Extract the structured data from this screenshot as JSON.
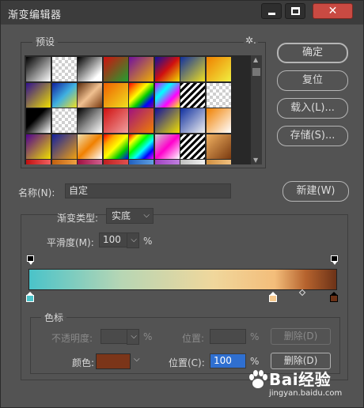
{
  "window": {
    "title": "渐变编辑器",
    "close_glyph": "✕"
  },
  "presets": {
    "label": "预设",
    "gear_glyph": "✲.",
    "swatches": [
      [
        "linear-gradient(135deg,#000,#fff)",
        "checker",
        "linear-gradient(135deg,#000,#fff 80%)",
        "linear-gradient(135deg,#d01010,#20a030)",
        "linear-gradient(135deg,#7010a0,#f0b000)",
        "linear-gradient(135deg,#1010a0,#d01010,#f0e000)",
        "linear-gradient(135deg,#1030a0,#f0e020)",
        "linear-gradient(135deg,#f08000,#f0f040)"
      ],
      [
        "linear-gradient(135deg,#301090,#f0e000)",
        "linear-gradient(135deg,#1020a0,#40b0e0,#f0e020)",
        "linear-gradient(135deg,#5a2a0a,#f0c090,#7a3a10)",
        "linear-gradient(135deg,#f06000,#f0e020)",
        "linear-gradient(135deg,#f00,#f80,#ff0,#0c0,#00f,#808)",
        "linear-gradient(135deg,#d0f,#0ff,#f0f,#ff0)",
        "stripes",
        "checker"
      ],
      [
        "linear-gradient(135deg,#000,#000 40%,#fff)",
        "checker",
        "linear-gradient(135deg,#000,#888,#fff)",
        "linear-gradient(135deg,#d01010,#f0a0a0)",
        "linear-gradient(135deg,#a01080,#f08000)",
        "linear-gradient(135deg,#1010a0,#f0e000)",
        "linear-gradient(135deg,#1030a0,#f0f0f0)",
        "linear-gradient(135deg,#f08000,#fff)"
      ],
      [
        "linear-gradient(135deg,#500090,#f0e000)",
        "linear-gradient(135deg,#1020a0,#f0a010)",
        "linear-gradient(135deg,#f0e0b0,#f08000,#fff)",
        "linear-gradient(135deg,#f00,#fa0,#ff0,#0c0,#00f)",
        "linear-gradient(135deg,#f00,#ff0,#0f0,#0ff,#00f,#f0f)",
        "linear-gradient(135deg,#ccc,#f0c,#fff)",
        "stripes",
        "linear-gradient(135deg,#f0b060,#7a3a10)"
      ],
      [
        "linear-gradient(to right,#c01010,#f06060)",
        "linear-gradient(to right,#c06010,#f0a040)",
        "linear-gradient(to right,#a01040,#d06090)",
        "linear-gradient(to right,#c02020,#e05050)",
        "linear-gradient(to right,#2060c0,#60a0e0)",
        "linear-gradient(to right,#a040c0,#c080e0)",
        "linear-gradient(to right,#c0c0c0,#f0f0f0)",
        "linear-gradient(to right,#d09040,#f0c080)"
      ]
    ]
  },
  "buttons": {
    "ok": "确定",
    "reset": "复位",
    "load": "载入(L)...",
    "save": "存储(S)...",
    "new": "新建(W)"
  },
  "name": {
    "label": "名称(N):",
    "value": "自定"
  },
  "gradient": {
    "type_label": "渐变类型:",
    "type_value": "实底",
    "smooth_label": "平滑度(M):",
    "smooth_value": "100",
    "smooth_unit": "%"
  },
  "color_stops": {
    "group_label": "色标",
    "opacity_label": "不透明度:",
    "opacity_unit": "%",
    "opacity_position_label": "位置:",
    "opacity_position_unit": "%",
    "opacity_delete": "删除(D)",
    "color_label": "颜色:",
    "color_value": "#7b3519",
    "color_position_label": "位置(C):",
    "color_position_value": "100",
    "color_position_unit": "%",
    "color_delete": "删除(D)"
  },
  "stops": {
    "left_color": "#4ac3c9",
    "mid_color": "#f6c98e",
    "right_color": "#6c3217"
  },
  "watermark": {
    "logo": "Bai经验",
    "url": "jingyan.baidu.com"
  }
}
